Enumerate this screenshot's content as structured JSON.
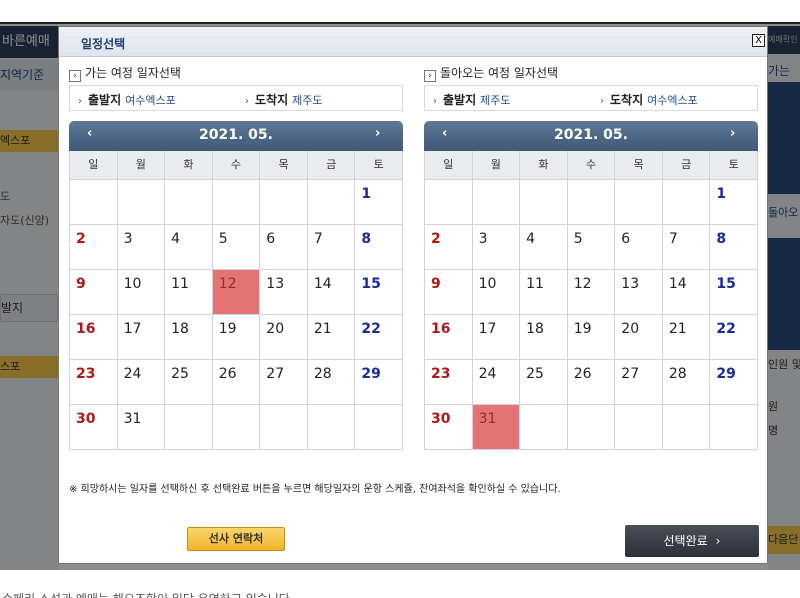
{
  "background": {
    "left_tab": "바른예매",
    "left_subtab": "지역기준",
    "left_items": [
      "엑스포",
      "도",
      "자도(신양)"
    ],
    "left_button": "발지",
    "left_selected": "스포",
    "right_tab1": "예매확인",
    "right_label1": "가는",
    "right_label2": "돌아오",
    "right_label3": "인원 및",
    "right_label4": "원",
    "right_label5": "명",
    "right_button": "다음단",
    "bottom_text": "수페리 소석과 예매는 해오즈항이 일단 우연하고 있습니다"
  },
  "modal": {
    "title": "일정선택",
    "close_label": "X",
    "notice": "※ 희망하시는 일자를 선택하신 후 선택완료 버튼을 누르면 해당일자의 운항 스케쥴, 잔여좌석을 확인하실 수 있습니다.",
    "contact_button": "선사 연락처",
    "done_button": "선택완료",
    "done_chevron": "›",
    "prev_arrow": "‹",
    "next_arrow": "›",
    "section_chevron": "›",
    "route_arrow": "›",
    "weekdays": [
      "일",
      "월",
      "화",
      "수",
      "목",
      "금",
      "토"
    ]
  },
  "outbound": {
    "title": "가는 여정 일자선택",
    "from_label": "출발지",
    "from_value": "여수엑스포",
    "to_label": "도착지",
    "to_value": "제주도",
    "month": "2021. 05.",
    "selected_day": 12
  },
  "return": {
    "title": "돌아오는 여정 일자선택",
    "from_label": "출발지",
    "from_value": "제주도",
    "to_label": "도착지",
    "to_value": "여수엑스포",
    "month": "2021. 05.",
    "selected_day": 31
  },
  "calendar": {
    "leading_blanks": 6,
    "days_in_month": 31,
    "trailing_blanks": 5
  }
}
